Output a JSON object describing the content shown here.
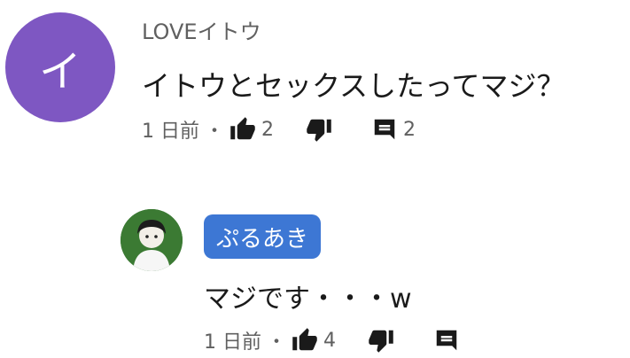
{
  "comment": {
    "avatar_letter": "イ",
    "avatar_color": "#7e57c2",
    "author": "LOVEイトウ",
    "text": "イトウとセックスしたってマジ？",
    "timestamp": "1 日前",
    "separator": "・",
    "like_count": "2",
    "reply_count": "2"
  },
  "reply": {
    "author": "ぷるあき",
    "author_badge_color": "#3d77d4",
    "text": "マジです・・・w",
    "timestamp": "1 日前",
    "separator": "・",
    "like_count": "4"
  },
  "icons": {
    "like": "thumb-up-icon",
    "dislike": "thumb-down-icon",
    "reply": "comment-icon"
  }
}
